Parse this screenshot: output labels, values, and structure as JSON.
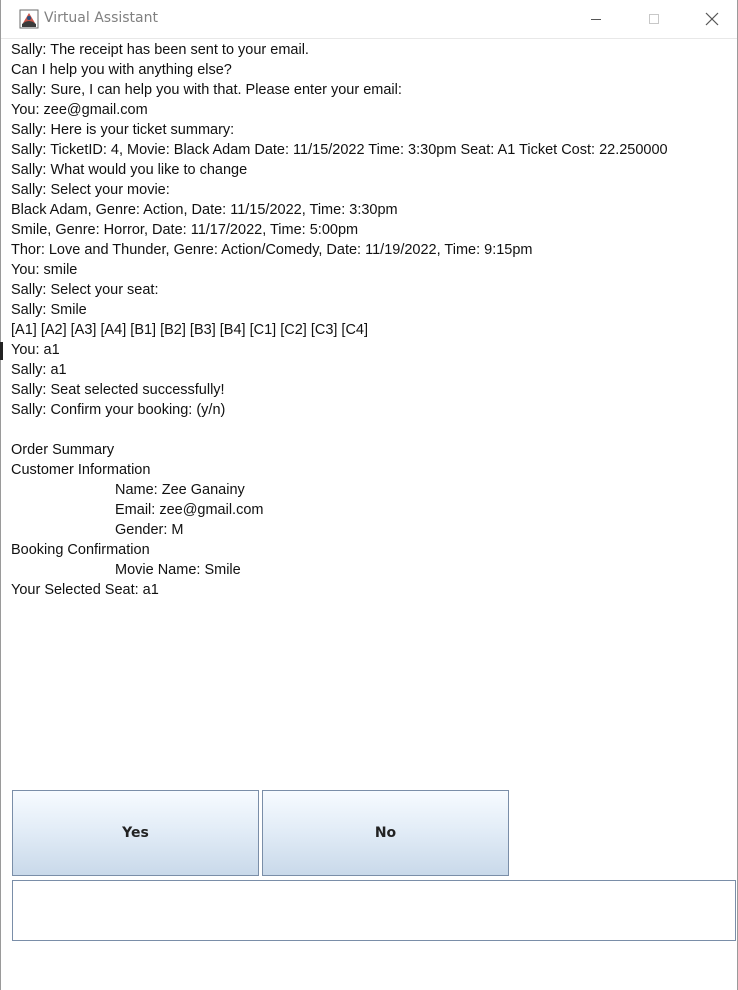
{
  "window": {
    "title": "Virtual Assistant",
    "icon": "java-cup-icon"
  },
  "chat": {
    "lines": [
      {
        "text": "Sally: The receipt has been sent to your email.",
        "indent": false
      },
      {
        "text": "Can I help you with anything else?",
        "indent": false
      },
      {
        "text": "Sally: Sure, I can help you with that. Please enter your email:",
        "indent": false
      },
      {
        "text": "You: zee@gmail.com",
        "indent": false
      },
      {
        "text": "Sally: Here is your ticket summary:",
        "indent": false
      },
      {
        "text": "Sally: TicketID: 4, Movie: Black Adam Date: 11/15/2022 Time: 3:30pm Seat: A1 Ticket Cost: 22.250000",
        "indent": false
      },
      {
        "text": "Sally: What would you like to change",
        "indent": false
      },
      {
        "text": "Sally: Select your movie:",
        "indent": false
      },
      {
        "text": "Black Adam, Genre: Action, Date: 11/15/2022, Time: 3:30pm",
        "indent": false
      },
      {
        "text": "Smile, Genre: Horror, Date: 11/17/2022, Time: 5:00pm",
        "indent": false
      },
      {
        "text": "Thor: Love and Thunder, Genre: Action/Comedy, Date: 11/19/2022, Time: 9:15pm",
        "indent": false
      },
      {
        "text": "You: smile",
        "indent": false
      },
      {
        "text": "Sally: Select your seat:",
        "indent": false
      },
      {
        "text": "Sally: Smile",
        "indent": false
      },
      {
        "text": "[A1] [A2] [A3] [A4] [B1] [B2] [B3] [B4] [C1] [C2] [C3] [C4]",
        "indent": false
      },
      {
        "text": "You: a1",
        "indent": false
      },
      {
        "text": "Sally: a1",
        "indent": false
      },
      {
        "text": "Sally: Seat selected successfully!",
        "indent": false
      },
      {
        "text": "Sally: Confirm your booking: (y/n)",
        "indent": false
      },
      {
        "text": "",
        "indent": false
      },
      {
        "text": "Order Summary",
        "indent": false
      },
      {
        "text": "Customer Information",
        "indent": false
      },
      {
        "text": "Name: Zee Ganainy",
        "indent": true
      },
      {
        "text": "Email: zee@gmail.com",
        "indent": true
      },
      {
        "text": "Gender: M",
        "indent": true
      },
      {
        "text": "Booking Confirmation",
        "indent": false
      },
      {
        "text": "Movie Name: Smile",
        "indent": true
      },
      {
        "text": "Your Selected Seat: a1",
        "indent": false
      }
    ]
  },
  "buttons": {
    "yes_label": "Yes",
    "no_label": "No"
  },
  "input": {
    "value": "",
    "placeholder": ""
  },
  "colors": {
    "button_border": "#7a8ea8",
    "button_gradient_top": "#f7fbff",
    "button_gradient_bottom": "#c9d9ea"
  }
}
